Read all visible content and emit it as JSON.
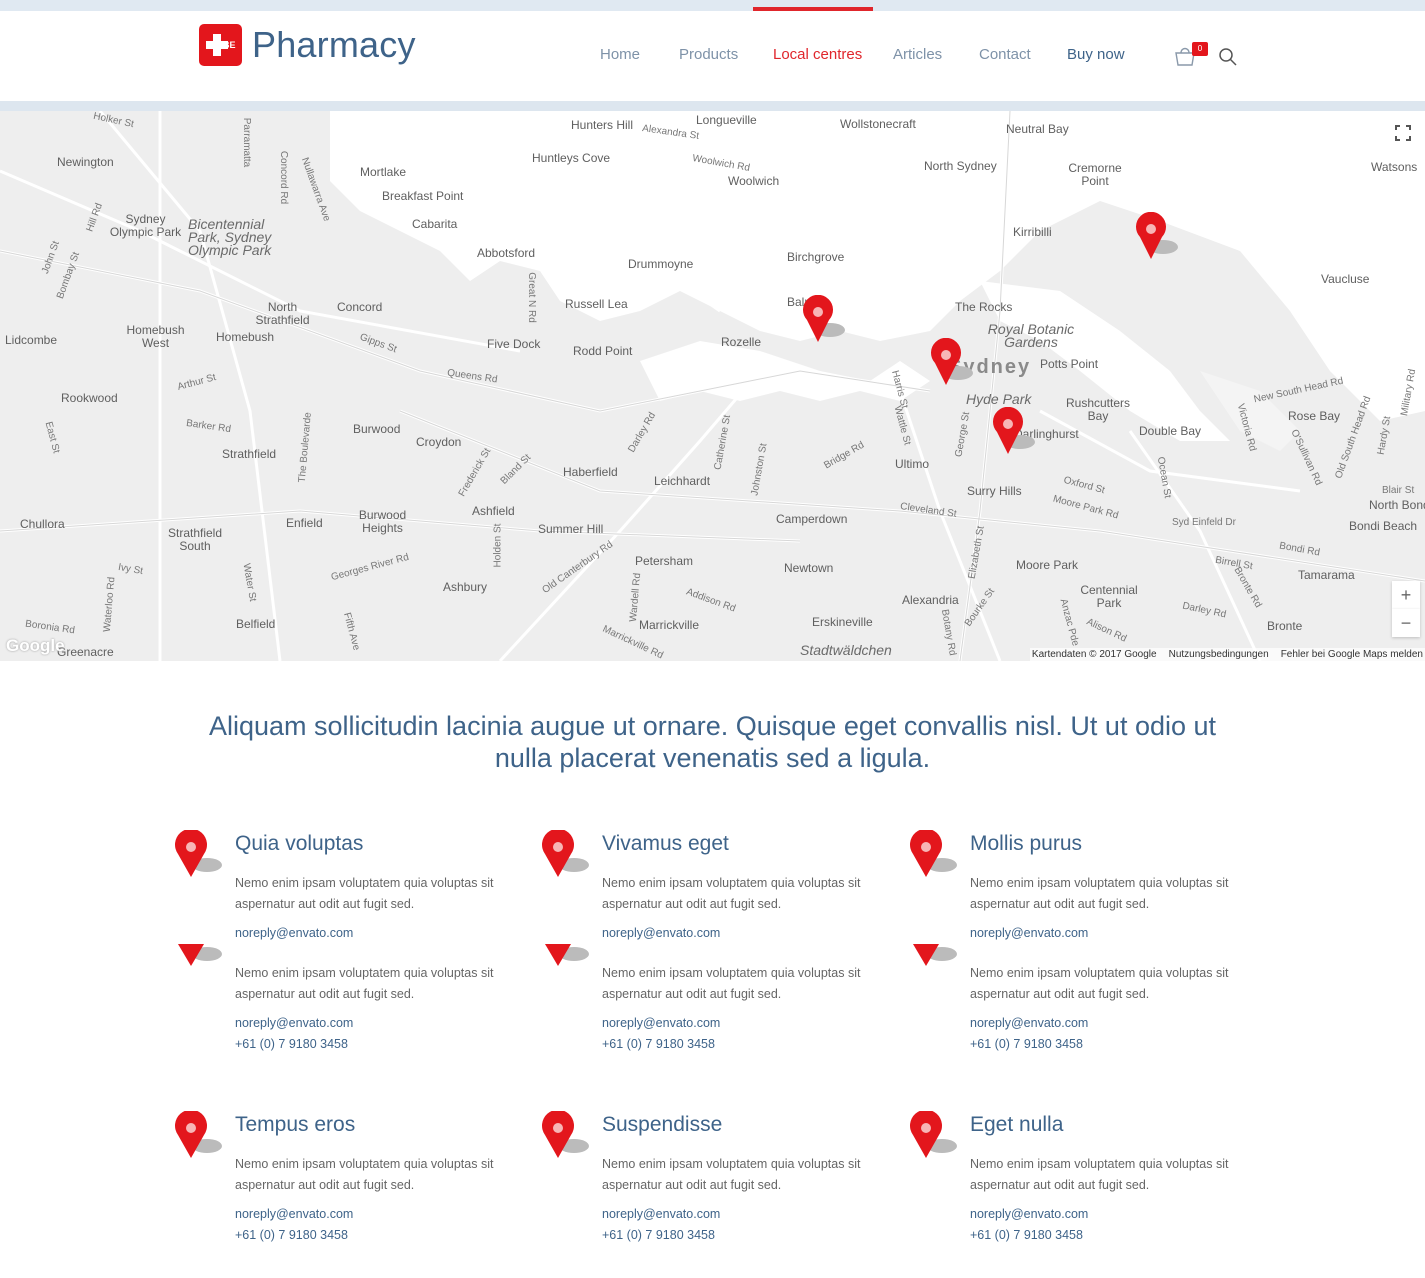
{
  "brand": {
    "name": "Pharmacy",
    "badge_text": "BE",
    "accent_color": "#e3161c",
    "primary_color": "#3e6389"
  },
  "nav": {
    "items": [
      "Home",
      "Products",
      "Local centres",
      "Articles",
      "Contact",
      "Buy now"
    ],
    "active": "Local centres",
    "cart_count": "0"
  },
  "map": {
    "labels": {
      "holker": "Holker St",
      "parramatta": "Parramatta",
      "hunters_hill": "Hunters Hill",
      "alexandra": "Alexandra St",
      "longueville": "Longueville",
      "wollstonecraft": "Wollstonecraft",
      "neutral_bay": "Neutral Bay",
      "watsons": "Watsons",
      "newington": "Newington",
      "concord_rd": "Concord Rd",
      "nullawarra": "Nullawarra Ave",
      "mortlake": "Mortlake",
      "huntleys_cove": "Huntleys Cove",
      "woolwich_rd": "Woolwich Rd",
      "woolwich": "Woolwich",
      "north_sydney": "North Sydney",
      "cremorne": "Cremorne Point",
      "breakfast_point": "Breakfast Point",
      "hill_rd": "Hill Rd",
      "sydney_park": "Sydney Olympic Park",
      "bicentennial": "Bicentennial Park, Sydney Olympic Park",
      "cabarita": "Cabarita",
      "kirribilli": "Kirribilli",
      "john_st": "John St",
      "bombay_st": "Bombay St",
      "abbotsford": "Abbotsford",
      "drummoyne": "Drummoyne",
      "birchgrove": "Birchgrove",
      "vaucluse": "Vaucluse",
      "great_north_rd": "Great N Rd",
      "north_strathfield": "North Strathfield",
      "concord": "Concord",
      "russell_lea": "Russell Lea",
      "balmain": "Balmain",
      "the_rocks": "The Rocks",
      "homebush_west": "Homebush West",
      "royal_botanic": "Royal Botanic Gardens",
      "lidcombe": "Lidcombe",
      "homebush": "Homebush",
      "gipps_st": "Gipps St",
      "five_dock": "Five Dock",
      "rodd_point": "Rodd Point",
      "rozelle": "Rozelle",
      "sydney": "Sydney",
      "potts_point": "Potts Point",
      "queens_rd": "Queens Rd",
      "arthur_st": "Arthur St",
      "harris_st": "Harris St",
      "new_south_head": "New South Head Rd",
      "military_rd": "Military Rd",
      "rookwood": "Rookwood",
      "hyde_park": "Hyde Park",
      "rushcutters": "Rushcutters Bay",
      "barker_rd": "Barker Rd",
      "the_boulevarde": "The Boulevarde",
      "burwood": "Burwood",
      "croydon": "Croydon",
      "darley_rd": "Darley Rd",
      "catherine_st": "Catherine St",
      "wattle_st": "Wattle St",
      "george_st": "George St",
      "darlinghurst": "Darlinghurst",
      "double_bay": "Double Bay",
      "victoria_rd": "Victoria Rd",
      "rose_bay": "Rose Bay",
      "osullivan": "O'Sullivan Rd",
      "old_south_head": "Old South Head Rd",
      "hardy_st": "Hardy St",
      "east_st": "East St",
      "strathfield": "Strathfield",
      "frederick_st": "Frederick St",
      "bland_st": "Bland St",
      "haberfield": "Haberfield",
      "johnston_st": "Johnston St",
      "bridge_rd": "Bridge Rd",
      "ultimo": "Ultimo",
      "surry_hills": "Surry Hills",
      "oxford_st": "Oxford St",
      "ocean_st": "Ocean St",
      "leichhardt": "Leichhardt",
      "blair_st": "Blair St",
      "north_bondi": "North Bondi",
      "chullora": "Chullora",
      "enfield": "Enfield",
      "burwood_heights": "Burwood Heights",
      "ashfield": "Ashfield",
      "camperdown": "Camperdown",
      "cleveland_st": "Cleveland St",
      "moore_park_rd": "Moore Park Rd",
      "syd_einfeld": "Syd Einfeld Dr",
      "bondi_beach": "Bondi Beach",
      "strathfield_south": "Strathfield South",
      "summer_hill": "Summer Hill",
      "holden_st": "Holden St",
      "elizabeth_st": "Elizabeth St",
      "bondi_rd": "Bondi Rd",
      "ivy_st": "Ivy St",
      "georges_river": "Georges River Rd",
      "old_canterbury": "Old Canterbury Rd",
      "petersham": "Petersham",
      "newtown": "Newtown",
      "moore_park": "Moore Park",
      "birrell_st": "Birrell St",
      "tamarama": "Tamarama",
      "water_st": "Water St",
      "ashbury": "Ashbury",
      "wardell_rd": "Wardell Rd",
      "addison_rd": "Addison Rd",
      "bourke_st": "Bourke St",
      "centennial": "Centennial Park",
      "bronte_rd": "Bronte Rd",
      "waterloo_rd": "Waterloo Rd",
      "alexandria": "Alexandria",
      "darley_rd2": "Darley Rd",
      "boronia": "Boronia Rd",
      "belfield": "Belfield",
      "fifth_ave": "Fifth Ave",
      "marrickville": "Marrickville",
      "erskineville": "Erskineville",
      "botany_rd": "Botany Rd",
      "anzac_pde": "Anzac Pde",
      "alison_rd": "Alison Rd",
      "bronte": "Bronte",
      "greenacre": "Greenacre",
      "marrickville_rd": "Marrickville Rd",
      "stadtwaldchen": "Stadtwäldchen"
    },
    "footer": [
      "Kartendaten © 2017 Google",
      "Nutzungsbedingungen",
      "Fehler bei Google Maps melden"
    ],
    "google": "Google",
    "zoom_in": "+",
    "zoom_out": "−"
  },
  "intro": "Aliquam sollicitudin lacinia augue ut ornare. Quisque eget convallis nisl. Ut ut odio ut nulla placerat venenatis sed a ligula.",
  "locations": [
    {
      "title": "Quia voluptas",
      "desc": "Nemo enim ipsam voluptatem quia voluptas sit aspernatur aut odit aut fugit sed.",
      "email": "noreply@envato.com",
      "desc2": "Nemo enim ipsam voluptatem quia voluptas sit aspernatur aut odit aut fugit sed.",
      "email2": "noreply@envato.com",
      "phone": "+61 (0) 7 9180 3458"
    },
    {
      "title": "Vivamus eget",
      "desc": "Nemo enim ipsam voluptatem quia voluptas sit aspernatur aut odit aut fugit sed.",
      "email": "noreply@envato.com",
      "desc2": "Nemo enim ipsam voluptatem quia voluptas sit aspernatur aut odit aut fugit sed.",
      "email2": "noreply@envato.com",
      "phone": "+61 (0) 7 9180 3458"
    },
    {
      "title": "Mollis purus",
      "desc": "Nemo enim ipsam voluptatem quia voluptas sit aspernatur aut odit aut fugit sed.",
      "email": "noreply@envato.com",
      "desc2": "Nemo enim ipsam voluptatem quia voluptas sit aspernatur aut odit aut fugit sed.",
      "email2": "noreply@envato.com",
      "phone": "+61 (0) 7 9180 3458"
    },
    {
      "title": "Tempus eros",
      "desc": "Nemo enim ipsam voluptatem quia voluptas sit aspernatur aut odit aut fugit sed.",
      "email": "noreply@envato.com",
      "phone": "+61 (0) 7 9180 3458"
    },
    {
      "title": "Suspendisse",
      "desc": "Nemo enim ipsam voluptatem quia voluptas sit aspernatur aut odit aut fugit sed.",
      "email": "noreply@envato.com",
      "phone": "+61 (0) 7 9180 3458"
    },
    {
      "title": "Eget nulla",
      "desc": "Nemo enim ipsam voluptatem quia voluptas sit aspernatur aut odit aut fugit sed.",
      "email": "noreply@envato.com",
      "phone": "+61 (0) 7 9180 3458"
    }
  ]
}
